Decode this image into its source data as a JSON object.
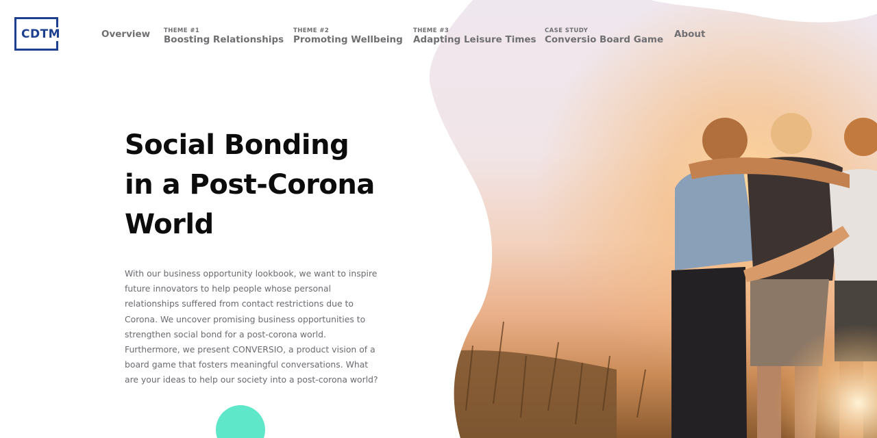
{
  "brand": {
    "logo_text": "CDTM"
  },
  "nav": {
    "overview": "Overview",
    "theme1": {
      "kicker": "THEME #1",
      "label": "Boosting Relationships"
    },
    "theme2": {
      "kicker": "THEME #2",
      "label": "Promoting Wellbeing"
    },
    "theme3": {
      "kicker": "THEME #3",
      "label": "Adapting Leisure Times"
    },
    "case_study": {
      "kicker": "CASE STUDY",
      "label": "Conversio Board Game"
    },
    "about": "About"
  },
  "hero": {
    "title_lines": [
      "Social Bonding",
      "in a Post-Corona",
      "World"
    ],
    "intro": "With our business opportunity lookbook, we want to inspire future innovators to help people whose personal relationships suffered from contact restrictions due to Corona. We uncover promising business opportunities to strengthen social bond for a post-corona world. Furthermore, we present CONVERSIO, a product vision of a board game that fosters meaningful conversations. What are your ideas to help our society into a post-corona world?"
  },
  "colors": {
    "brand_blue": "#1c3f8f",
    "accent_mint": "#5ee7c8",
    "nav_gray": "#6f6f72",
    "body_gray": "#6a6a70"
  }
}
